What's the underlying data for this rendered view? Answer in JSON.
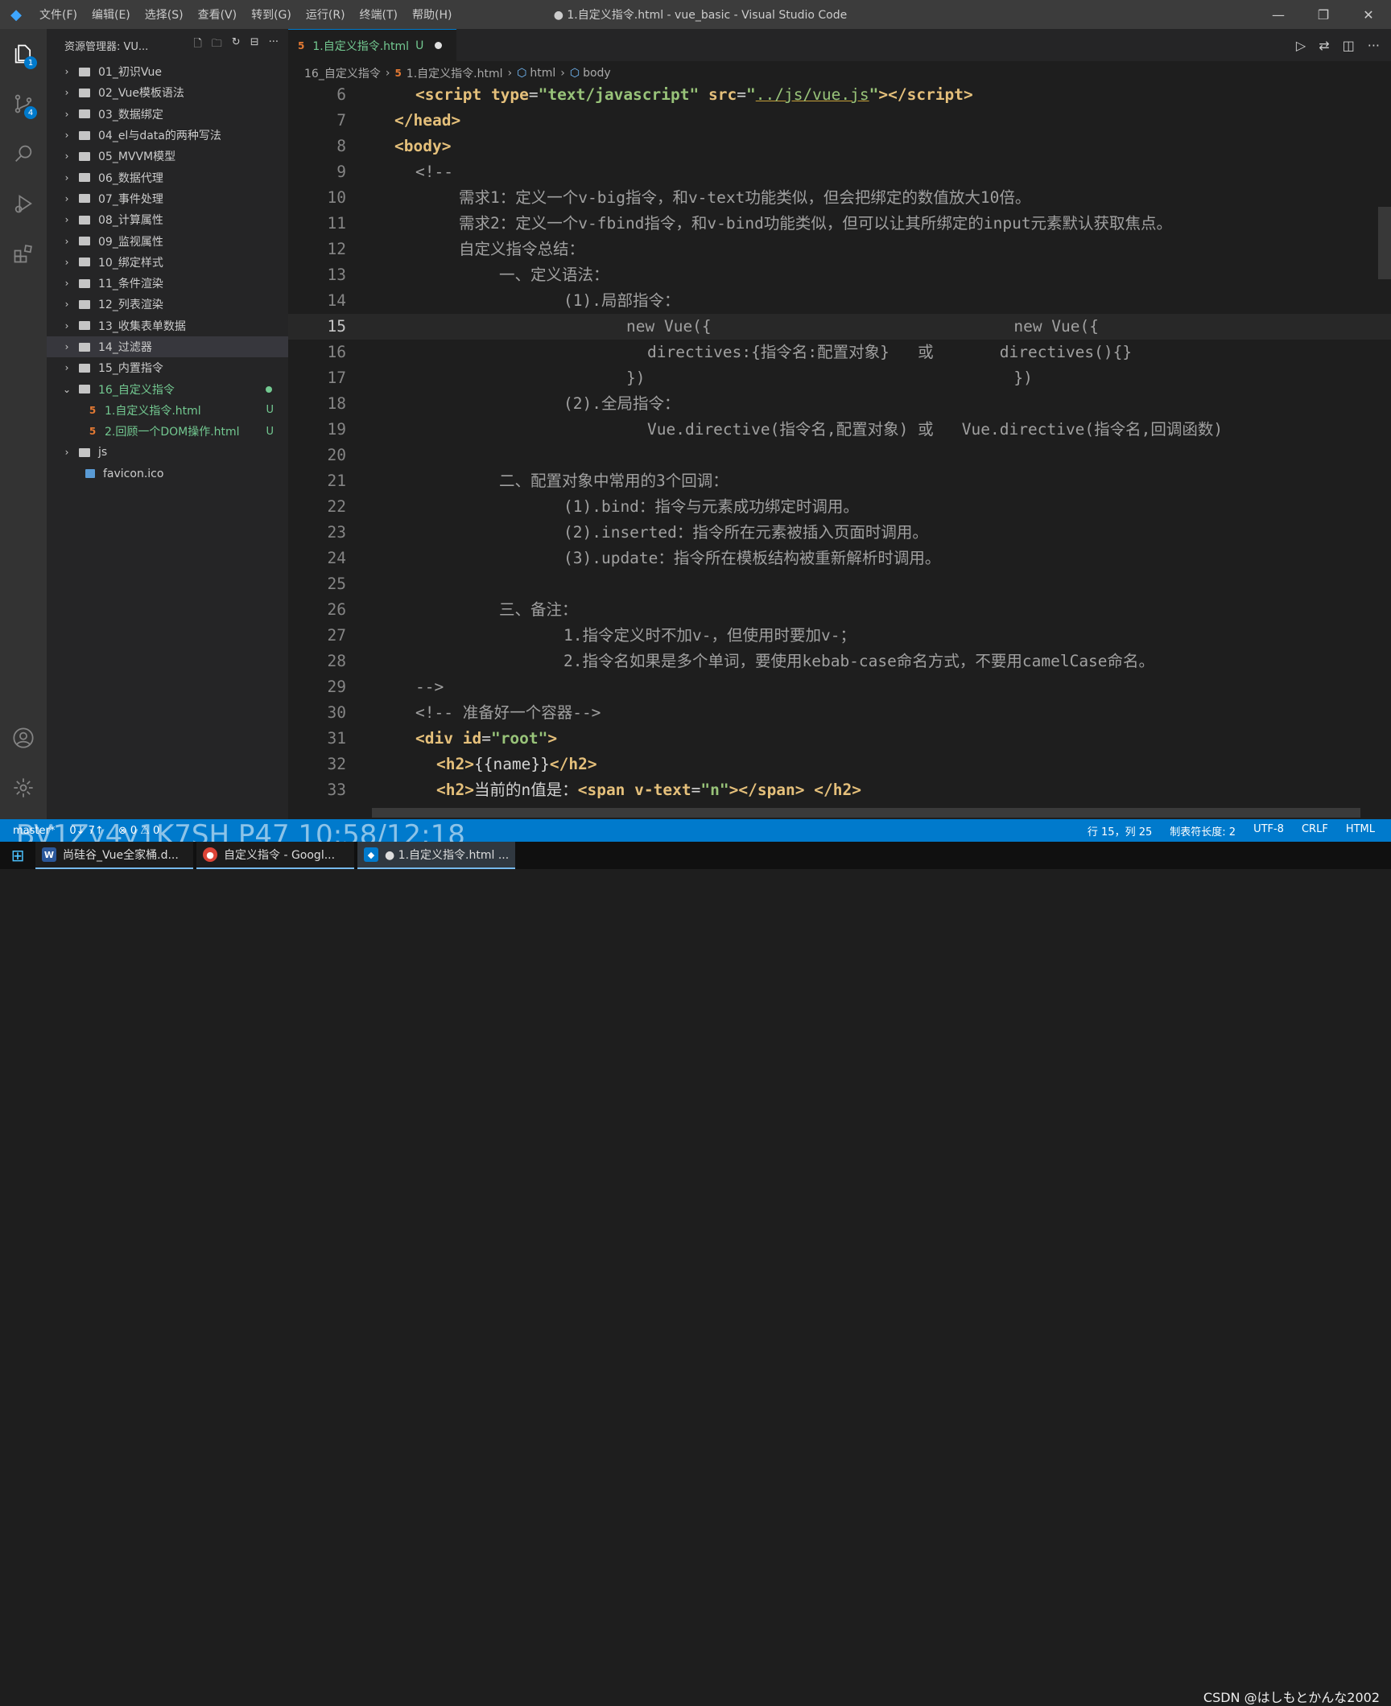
{
  "titlebar": {
    "menu": [
      "文件(F)",
      "编辑(E)",
      "选择(S)",
      "查看(V)",
      "转到(G)",
      "运行(R)",
      "终端(T)",
      "帮助(H)"
    ],
    "title": "● 1.自定义指令.html - vue_basic - Visual Studio Code",
    "minimize": "—",
    "restore": "❐",
    "close": "✕"
  },
  "activity": {
    "explorer_badge": "1",
    "scm_badge": "4"
  },
  "explorer": {
    "header": "资源管理器: VU...",
    "items": [
      {
        "label": "01_初识Vue"
      },
      {
        "label": "02_Vue模板语法"
      },
      {
        "label": "03_数据绑定"
      },
      {
        "label": "04_el与data的两种写法"
      },
      {
        "label": "05_MVVM模型"
      },
      {
        "label": "06_数据代理"
      },
      {
        "label": "07_事件处理"
      },
      {
        "label": "08_计算属性"
      },
      {
        "label": "09_监视属性"
      },
      {
        "label": "10_绑定样式"
      },
      {
        "label": "11_条件渲染"
      },
      {
        "label": "12_列表渲染"
      },
      {
        "label": "13_收集表单数据"
      },
      {
        "label": "14_过滤器"
      },
      {
        "label": "15_内置指令"
      },
      {
        "label": "16_自定义指令"
      },
      {
        "label": "1.自定义指令.html",
        "status": "U"
      },
      {
        "label": "2.回顾一个DOM操作.html",
        "status": "U"
      },
      {
        "label": "js"
      },
      {
        "label": "favicon.ico"
      }
    ]
  },
  "tab": {
    "label": "1.自定义指令.html",
    "status": "U"
  },
  "breadcrumb": {
    "folder": "16_自定义指令",
    "file": "1.自定义指令.html",
    "node1": "html",
    "node2": "body"
  },
  "editor": {
    "lines": [
      {
        "n": "6"
      },
      {
        "n": "7"
      },
      {
        "n": "8"
      },
      {
        "n": "9"
      },
      {
        "n": "10"
      },
      {
        "n": "11"
      },
      {
        "n": "12"
      },
      {
        "n": "13"
      },
      {
        "n": "14"
      },
      {
        "n": "15"
      },
      {
        "n": "16"
      },
      {
        "n": "17"
      },
      {
        "n": "18"
      },
      {
        "n": "19"
      },
      {
        "n": "20"
      },
      {
        "n": "21"
      },
      {
        "n": "22"
      },
      {
        "n": "23"
      },
      {
        "n": "24"
      },
      {
        "n": "25"
      },
      {
        "n": "26"
      },
      {
        "n": "27"
      },
      {
        "n": "28"
      },
      {
        "n": "29"
      },
      {
        "n": "30"
      },
      {
        "n": "31"
      },
      {
        "n": "32"
      },
      {
        "n": "33"
      }
    ]
  },
  "statusbar": {
    "branch": "master*",
    "sync": "0↓ 7↑",
    "problems": "⊗ 0 ⚠ 0",
    "position": "行 15，列 25",
    "tabsize": "制表符长度: 2",
    "encoding": "UTF-8",
    "eol": "CRLF",
    "lang": "HTML"
  },
  "taskbar": {
    "items": [
      {
        "label": "尚硅谷_Vue全家桶.d..."
      },
      {
        "label": "自定义指令 - Googl..."
      },
      {
        "label": "● 1.自定义指令.html ..."
      }
    ]
  },
  "overlay": {
    "watermark": "BV1Zy4y1K7SH P47 10:58/12:18",
    "credit": "CSDN @はしもとかんな2002"
  }
}
